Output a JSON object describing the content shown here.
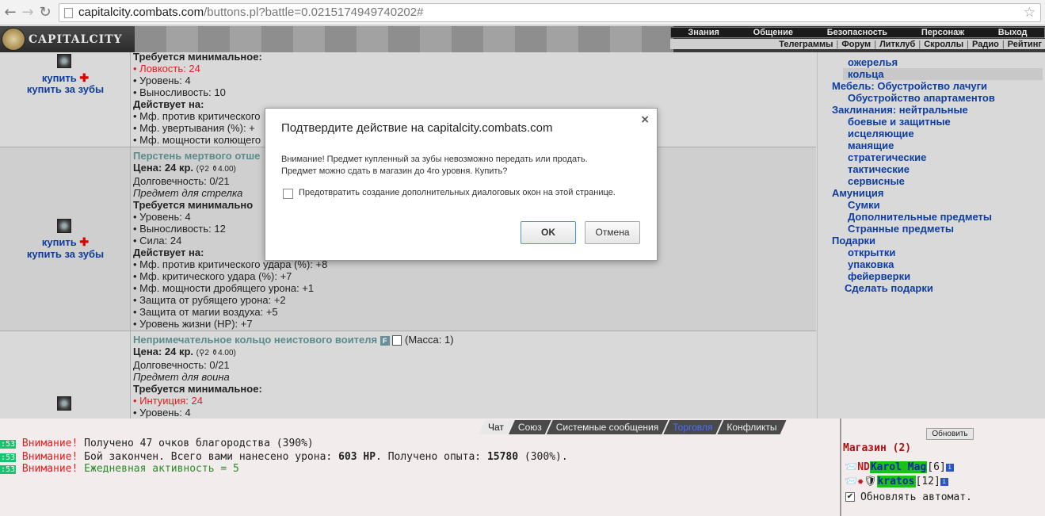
{
  "browser": {
    "url_host": "capitalcity.combats.com",
    "url_rest": "/buttons.pl?battle=0.0215174949740202#"
  },
  "header": {
    "logo_text": "CAPITALCITY",
    "top_menu": [
      "Знания",
      "Общение",
      "Безопасность",
      "Персонаж",
      "Выход"
    ],
    "sub_menu": [
      "Телеграммы",
      "Форум",
      "Литклуб",
      "Скроллы",
      "Радио",
      "Рейтинг"
    ]
  },
  "items": [
    {
      "buy": "купить",
      "buy_teeth": "купить за зубы",
      "req_title": "Требуется минимальное:",
      "reqs": [
        "Ловкость: 24",
        "Уровень: 4",
        "Выносливость: 10"
      ],
      "effects_title": "Действует на:",
      "effects": [
        "Мф. против критического",
        "Мф. увертывания (%): +",
        "Мф. мощности колющего"
      ]
    },
    {
      "name": "Перстень мертвого отше",
      "price": "Цена: 24 кр.",
      "price_extra": "(",
      "price_extra_rest": "2 ",
      "price_extra_end": "4.00)",
      "durability": "Долговечность: 0/21",
      "class": "Предмет для стрелка",
      "req_title": "Требуется минимально",
      "reqs": [
        "Уровень: 4",
        "Выносливость: 12",
        "Сила: 24"
      ],
      "effects_title": "Действует на:",
      "effects": [
        "Мф. против критического удара (%): +8",
        "Мф. критического удара (%): +7",
        "Мф. мощности дробящего урона: +1",
        "Защита от рубящего урона: +2",
        "Защита от магии воздуха: +5",
        "Уровень жизни (HP): +7"
      ],
      "buy": "купить",
      "buy_teeth": "купить за зубы"
    },
    {
      "name": "Непримечательное кольцо неистового воителя",
      "badge": "F",
      "mass": "(Масса: 1)",
      "price": "Цена: 24 кр.",
      "price_extra": "(",
      "price_extra_rest": "2 ",
      "price_extra_end": "4.00)",
      "durability": "Долговечность: 0/21",
      "class": "Предмет для воина",
      "req_title": "Требуется минимальное:",
      "reqs": [
        "Интуиция: 24",
        "Уровень: 4"
      ]
    }
  ],
  "categories": [
    {
      "label": "ожерелья",
      "sub": true
    },
    {
      "label": "кольца",
      "sub": true,
      "selected": true
    },
    {
      "label": "Мебель: Обустройство лачуги",
      "sub": false
    },
    {
      "label": "Обустройство апартаментов",
      "sub": true
    },
    {
      "label": "Заклинания: нейтральные",
      "sub": false
    },
    {
      "label": "боевые и защитные",
      "sub": true
    },
    {
      "label": "исцеляющие",
      "sub": true
    },
    {
      "label": "манящие",
      "sub": true
    },
    {
      "label": "стратегические",
      "sub": true
    },
    {
      "label": "тактические",
      "sub": true
    },
    {
      "label": "сервисные",
      "sub": true
    },
    {
      "label": "Амуниция",
      "sub": false
    },
    {
      "label": "Сумки",
      "sub": true
    },
    {
      "label": "Дополнительные предметы",
      "sub": true
    },
    {
      "label": "Странные предметы",
      "sub": true
    },
    {
      "label": "Подарки",
      "sub": false
    },
    {
      "label": "открытки",
      "sub": true
    },
    {
      "label": "упаковка",
      "sub": true
    },
    {
      "label": "фейерверки",
      "sub": true
    },
    {
      "label": "Сделать подарки",
      "sub": "gift"
    }
  ],
  "dialog": {
    "title": "Подтвердите действие на capitalcity.combats.com",
    "close": "×",
    "message_line1": "Внимание! Предмет купленный за зубы невозможно передать или продать.",
    "message_line2": "Предмет можно сдать в магазин до 4го уровня. Купить?",
    "checkbox_label": "Предотвратить создание дополнительных диалоговых окон на этой странице.",
    "ok": "OK",
    "cancel": "Отмена"
  },
  "chat": {
    "tabs": [
      "Чат",
      "Союз",
      "Системные сообщения",
      "Торговля",
      "Конфликты"
    ],
    "messages": [
      {
        "ts": ":53",
        "warn": "Внимание!",
        "text": "Получено 47 очков благородства (390%)"
      },
      {
        "ts": ":53",
        "warn": "Внимание!",
        "text_a": "Бой закончен. Всего вами нанесено урона:",
        "bold_a": "603 HP",
        "text_b": ". Получено опыта:",
        "bold_b": "15780",
        "text_c": "(300%)."
      },
      {
        "ts": ":53",
        "warn": "Внимание!",
        "text_green": "Ежедневная активность = 5"
      }
    ]
  },
  "shop": {
    "refresh": "Обновить",
    "title": "Магазин (2)",
    "users": [
      {
        "icons": "ND",
        "name": "Karol Mag",
        "level": "[6]"
      },
      {
        "icons": "",
        "name": "kratos",
        "level": "[12]"
      }
    ],
    "auto_label": "Обновлять автомат.",
    "auto_checked": "✔"
  },
  "colors": {
    "link": "#0d3da1",
    "warning": "#e02020",
    "item_name": "#5a8c8c"
  }
}
